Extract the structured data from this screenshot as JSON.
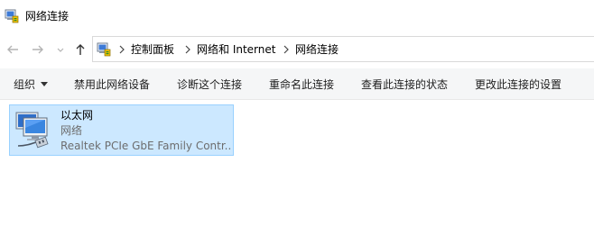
{
  "window": {
    "title": "网络连接",
    "icon": "network-connections-icon"
  },
  "navigation": {
    "back_icon": "arrow-left-icon",
    "forward_icon": "arrow-right-icon",
    "recent_icon": "chevron-down-icon",
    "up_icon": "arrow-up-icon",
    "breadcrumb": [
      "控制面板",
      "网络和 Internet",
      "网络连接"
    ]
  },
  "commands": {
    "organize": "组织",
    "disable_device": "禁用此网络设备",
    "diagnose": "诊断这个连接",
    "rename": "重命名此连接",
    "view_status": "查看此连接的状态",
    "change_settings": "更改此连接的设置"
  },
  "connections": [
    {
      "name": "以太网",
      "network": "网络",
      "device": "Realtek PCIe GbE Family Contr...",
      "icon": "ethernet-adapter-icon",
      "selected": true
    }
  ],
  "colors": {
    "selection_background": "#cce8ff",
    "selection_border": "#99d1ff",
    "command_bar_background": "#f5f6f7",
    "secondary_text": "#6d6d6d"
  }
}
